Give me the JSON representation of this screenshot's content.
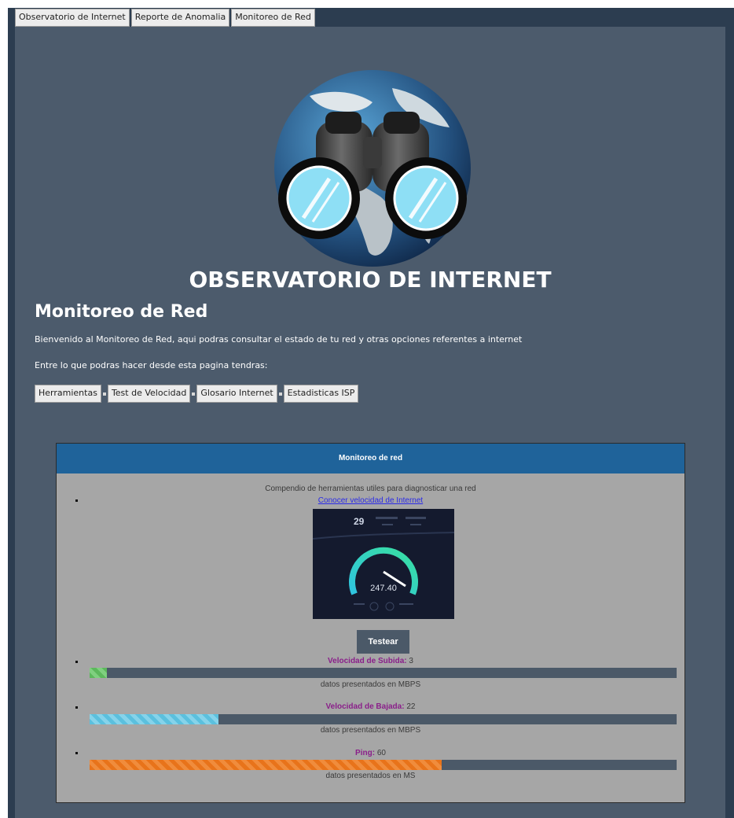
{
  "tabs": [
    "Observatorio de Internet",
    "Reporte de Anomalia",
    "Monitoreo de Red"
  ],
  "site_title": "OBSERVATORIO DE INTERNET",
  "page_title": "Monitoreo de Red",
  "intro": "Bienvenido al Monitoreo de Red, aqui podras consultar el estado de tu red y otras opciones referentes a internet",
  "intro2": "Entre lo que podras hacer desde esta pagina tendras:",
  "nav_buttons": [
    "Herramientas",
    "Test de Velocidad",
    "Glosario Internet",
    "Estadisticas ISP"
  ],
  "panel": {
    "header": "Monitoreo de red",
    "description": "Compendio de herramientas utiles para diagnosticar una red",
    "speed_link": "Conocer velocidad de Internet",
    "speedtest_image": {
      "reading": "247.40"
    },
    "test_button": "Testear",
    "metrics": [
      {
        "name": "Velocidad de Subida",
        "value": "3",
        "unit_text": "datos presentados en MBPS",
        "fill": 0.03
      },
      {
        "name": "Velocidad de Bajada",
        "value": "22",
        "unit_text": "datos presentados en MBPS",
        "fill": 0.22
      },
      {
        "name": "Ping",
        "value": "60",
        "unit_text": "datos presentados en MS",
        "fill": 0.6
      }
    ]
  },
  "colors": {
    "frame": "#2c3d50",
    "content_bg": "#4c5b6c",
    "panel_header": "#1f639a",
    "panel_bg": "#a6a6a6",
    "upload_bar": "#5cb85c",
    "download_bar": "#5bc0de",
    "ping_bar": "#e8731a",
    "metric_name": "#8a1f8a"
  }
}
